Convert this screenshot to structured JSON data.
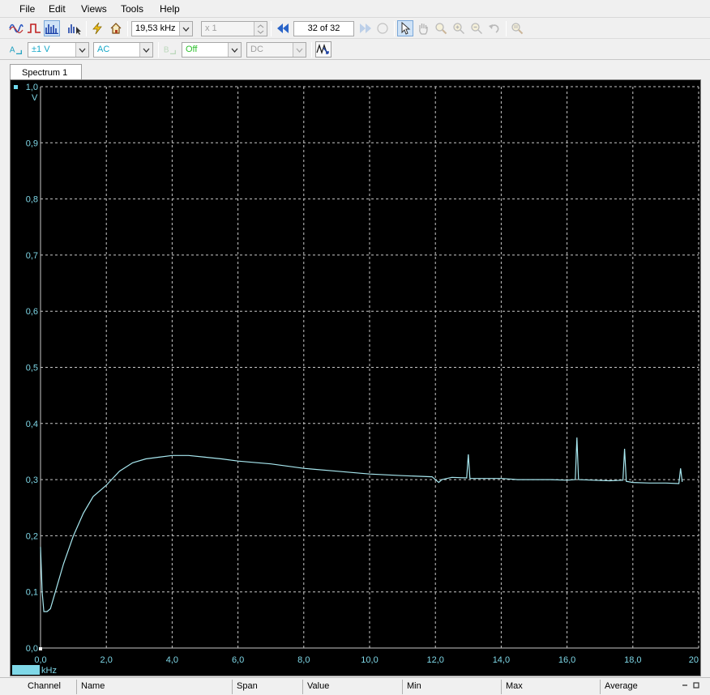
{
  "menu": [
    {
      "label": "File"
    },
    {
      "label": "Edit"
    },
    {
      "label": "Views"
    },
    {
      "label": "Tools"
    },
    {
      "label": "Help"
    }
  ],
  "toolbar": {
    "timebase": "19,53 kHz",
    "zoom_multiplier": "x 1",
    "buffer_position": "32  of 32"
  },
  "channel_bar": {
    "channel_letter": "A",
    "range": "±1 V",
    "coupling": "AC",
    "trigger_letter": "B",
    "trigger_mode": "Off",
    "trigger_coupling": "DC"
  },
  "tab": {
    "label": "Spectrum 1"
  },
  "colors": {
    "trace": "#a8e8f0",
    "axis_text": "#7fd8e8",
    "grid": "#c8c8c8",
    "background": "#000000"
  },
  "chart_data": {
    "type": "line",
    "title": "",
    "ylabel": "V",
    "xlabel": "kHz",
    "xlim": [
      0,
      20
    ],
    "ylim": [
      0,
      1.0
    ],
    "grid": true,
    "x_ticks": [
      "0,0",
      "2,0",
      "4,0",
      "6,0",
      "8,0",
      "10,0",
      "12,0",
      "14,0",
      "16,0",
      "18,0",
      "20"
    ],
    "y_ticks": [
      "0,0",
      "0,1",
      "0,2",
      "0,3",
      "0,4",
      "0,5",
      "0,6",
      "0,7",
      "0,8",
      "0,9",
      "1,0"
    ],
    "series": [
      {
        "x": [
          0.0,
          0.05,
          0.1,
          0.2,
          0.3,
          0.5,
          0.7,
          1.0,
          1.3,
          1.6,
          2.0,
          2.4,
          2.8,
          3.2,
          3.6,
          4.0,
          4.5,
          5.0,
          5.5,
          6.0,
          7.0,
          8.0,
          9.0,
          10.0,
          11.0,
          11.9,
          12.1,
          12.2,
          12.5,
          12.95,
          13.0,
          13.05,
          13.5,
          14.0,
          14.5,
          15.0,
          15.5,
          16.0,
          16.25,
          16.3,
          16.35,
          16.8,
          17.3,
          17.7,
          17.75,
          17.8,
          18.0,
          18.5,
          19.0,
          19.4,
          19.45,
          19.5
        ],
        "y": [
          0.18,
          0.1,
          0.065,
          0.065,
          0.07,
          0.11,
          0.15,
          0.2,
          0.24,
          0.27,
          0.29,
          0.315,
          0.33,
          0.337,
          0.34,
          0.343,
          0.343,
          0.34,
          0.337,
          0.333,
          0.328,
          0.32,
          0.315,
          0.31,
          0.307,
          0.305,
          0.295,
          0.3,
          0.304,
          0.303,
          0.345,
          0.302,
          0.302,
          0.302,
          0.3,
          0.3,
          0.3,
          0.299,
          0.3,
          0.375,
          0.3,
          0.299,
          0.298,
          0.299,
          0.355,
          0.297,
          0.295,
          0.294,
          0.294,
          0.293,
          0.32,
          0.296
        ]
      }
    ]
  },
  "status_columns": [
    "Channel",
    "Name",
    "Span",
    "Value",
    "Min",
    "Max",
    "Average"
  ]
}
